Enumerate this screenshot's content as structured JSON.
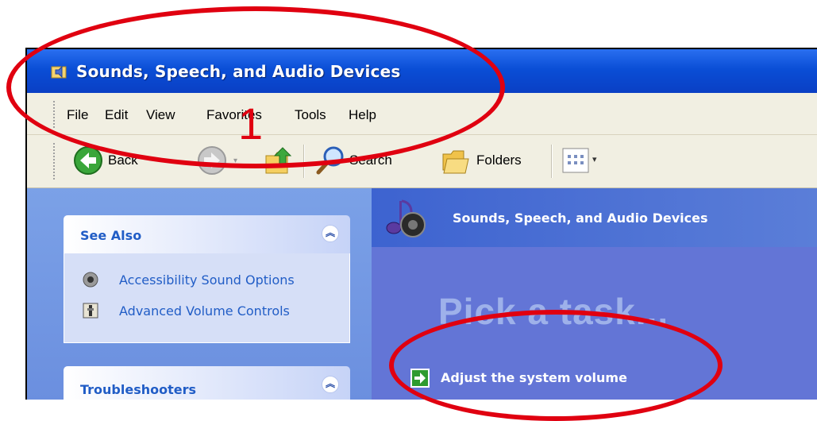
{
  "window": {
    "title": "Sounds, Speech, and Audio Devices"
  },
  "menu": {
    "items": [
      "File",
      "Edit",
      "View",
      "Favorites",
      "Tools",
      "Help"
    ]
  },
  "toolbar": {
    "back_label": "Back",
    "search_label": "Search",
    "folders_label": "Folders"
  },
  "see_also": {
    "title": "See Also",
    "links": [
      "Accessibility Sound Options",
      "Advanced Volume Controls"
    ]
  },
  "troubleshooters": {
    "title": "Troubleshooters"
  },
  "category": {
    "title": "Sounds, Speech, and Audio Devices"
  },
  "main": {
    "heading": "Pick a task...",
    "tasks": [
      "Adjust the system volume"
    ]
  },
  "annotation": {
    "number": "1",
    "color": "#e00010"
  },
  "colors": {
    "titlebar": "#0a4ed6",
    "task_pane": "#6b8fdf",
    "content_pane": "#6375d6",
    "link": "#215dc6"
  }
}
